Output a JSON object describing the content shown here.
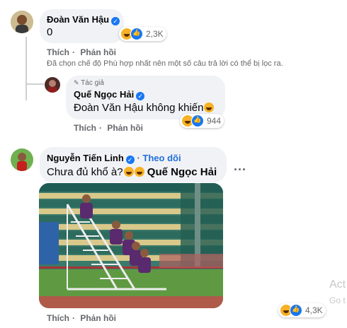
{
  "comments": [
    {
      "author": "Đoàn Văn Hậu",
      "text": "0",
      "reaction_count": "2,3K",
      "actions": {
        "like": "Thích",
        "reply": "Phản hồi"
      }
    },
    {
      "badge": "Tác giả",
      "author": "Quế Ngọc Hải",
      "text": "Đoàn Văn Hậu không khiến",
      "reaction_count": "944",
      "actions": {
        "like": "Thích",
        "reply": "Phản hồi"
      }
    },
    {
      "author": "Nguyễn Tiến Linh",
      "follow": "Theo dõi",
      "text_prefix": "Chưa đủ khổ à?",
      "mention": "Quế Ngọc Hải",
      "reaction_count": "4,3K",
      "actions": {
        "like": "Thích",
        "reply": "Phản hồi"
      }
    }
  ],
  "filter_note": "Đã chọn chế độ Phù hợp nhất nên một số câu trả lời có thể bị lọc ra.",
  "more_options": "...",
  "watermark": {
    "line1": "Act",
    "line2": "Go t"
  }
}
